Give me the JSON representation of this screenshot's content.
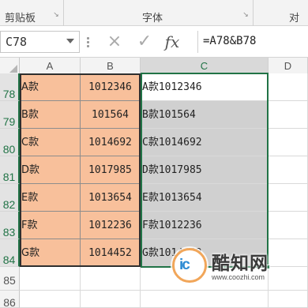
{
  "ribbon": {
    "groups": [
      "剪贴板",
      "字体",
      "对齐"
    ]
  },
  "formula_bar": {
    "name_box": "C78",
    "cancel_icon": "×",
    "enter_icon": "✓",
    "fx_label": "fx",
    "formula": "=A78&B78"
  },
  "columns": [
    "A",
    "B",
    "C",
    "D"
  ],
  "rows": [
    {
      "num": "78",
      "a": "A款",
      "b": "1012346",
      "c": "A款1012346"
    },
    {
      "num": "79",
      "a": "B款",
      "b": "101564",
      "c": "B款101564"
    },
    {
      "num": "80",
      "a": "C款",
      "b": "1014692",
      "c": "C款1014692"
    },
    {
      "num": "81",
      "a": "D款",
      "b": "1017985",
      "c": "D款1017985"
    },
    {
      "num": "82",
      "a": "E款",
      "b": "1013654",
      "c": "E款1013654"
    },
    {
      "num": "83",
      "a": "F款",
      "b": "1012236",
      "c": "F款1012236"
    },
    {
      "num": "84",
      "a": "G款",
      "b": "1014452",
      "c": "G款1014452"
    }
  ],
  "extra_rows": [
    "85",
    "86"
  ],
  "watermark": {
    "brand": "酷知网",
    "url": "www.coozhi.com",
    "logo_text": "ic"
  }
}
